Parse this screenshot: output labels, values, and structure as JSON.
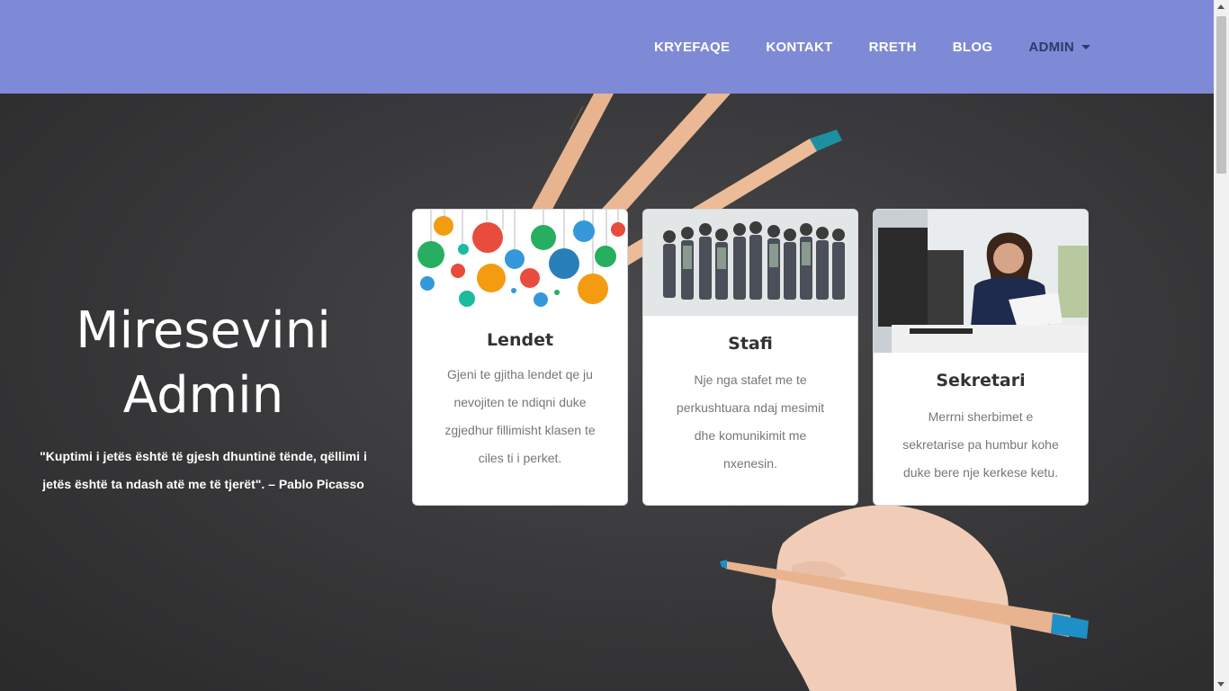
{
  "nav": {
    "items": [
      "KRYEFAQE",
      "KONTAKT",
      "RRETH",
      "BLOG"
    ],
    "admin_label": "ADMIN"
  },
  "hero": {
    "title_line1": "Miresevini",
    "title_line2": "Admin",
    "quote": "\"Kuptimi i jetës është të gjesh dhuntinë tënde, qëllimi i jetës është ta ndash atë me të tjerët\". – Pablo Picasso"
  },
  "cards": [
    {
      "title": "Lendet",
      "text": "Gjeni te gjitha lendet qe ju nevojiten te ndiqni duke zgjedhur fillimisht klasen te ciles ti i perket."
    },
    {
      "title": "Stafi",
      "text": "Nje nga stafet me te perkushtuara ndaj mesimit dhe komunikimit me nxenesin."
    },
    {
      "title": "Sekretari",
      "text": "Merrni sherbimet e sekretarise pa humbur kohe duke bere nje kerkese ketu."
    }
  ],
  "colors": {
    "navbar": "#7f8ad6",
    "admin_text": "#2c3a6b",
    "hero_bg": "#3a3a3c",
    "pencil": "#e8b48f",
    "pencil_tip": "#1e8fc7"
  }
}
